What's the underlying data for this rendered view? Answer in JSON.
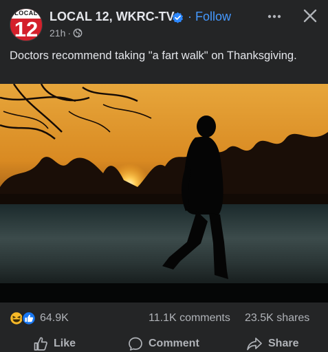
{
  "post": {
    "page_name": "LOCAL 12, WKRC-TV",
    "avatar_top_text": "LOCAL",
    "avatar_number": "12",
    "follow_dot": "·",
    "follow_label": "Follow",
    "time_ago": "21h",
    "meta_dot": "·",
    "caption": "Doctors recommend taking \"a fart walk\" on Thanksgiving."
  },
  "stats": {
    "reactions_count": "64.9K",
    "comments": "11.1K comments",
    "shares": "23.5K shares"
  },
  "actions": {
    "like": "Like",
    "comment": "Comment",
    "share": "Share"
  },
  "icons": {
    "verified": "verified-badge-icon",
    "globe": "globe-icon",
    "more": "more-options-icon",
    "close": "close-icon",
    "haha": "haha-reaction-icon",
    "like_reaction": "like-reaction-icon",
    "like": "thumbs-up-icon",
    "comment": "comment-bubble-icon",
    "share": "share-arrow-icon"
  },
  "colors": {
    "background": "#242526",
    "accent": "#4599ff",
    "text": "#e4e6eb",
    "muted": "#b0b3b8"
  }
}
